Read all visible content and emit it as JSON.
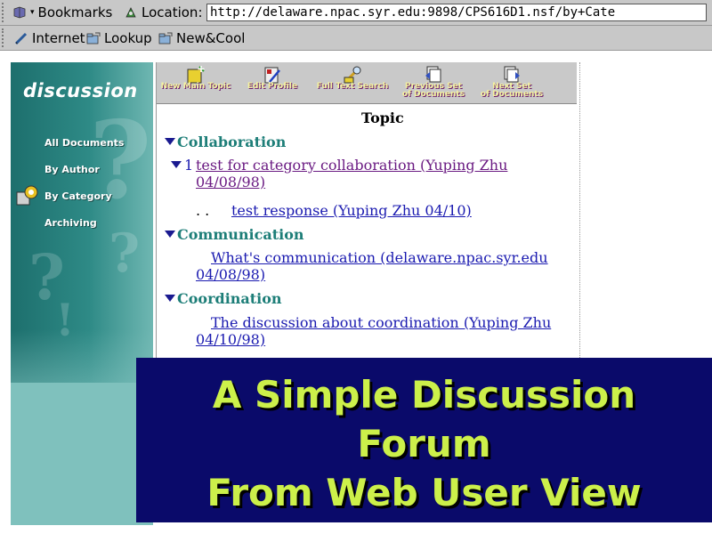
{
  "browser": {
    "toolbar": {
      "bookmarks_label": "Bookmarks",
      "location_label": "Location:",
      "url": "http://delaware.npac.syr.edu:9898/CPS616D1.nsf/by+Cate"
    },
    "personal_toolbar": [
      {
        "label": "Internet"
      },
      {
        "label": "Lookup"
      },
      {
        "label": "New&Cool"
      }
    ]
  },
  "sidebar": {
    "brand": "discussion",
    "links": [
      {
        "label": "All Documents"
      },
      {
        "label": "By Author"
      },
      {
        "label": "By Category"
      },
      {
        "label": "Archiving"
      }
    ]
  },
  "action_bar": [
    {
      "label": "New Main Topic",
      "icon": "new-topic-icon"
    },
    {
      "label": "Edit Profile",
      "icon": "edit-profile-icon"
    },
    {
      "label": "Full Text Search",
      "icon": "search-icon"
    },
    {
      "label_line1": "Previous Set",
      "label_line2": "of Documents",
      "icon": "previous-set-icon"
    },
    {
      "label_line1": "Next Set",
      "label_line2": "of Documents",
      "icon": "next-set-icon"
    }
  ],
  "view": {
    "column_header": "Topic",
    "categories": [
      {
        "name": "Collaboration",
        "documents": [
          {
            "count": "1",
            "title_line1": "test for category collaboration (Yuping Zhu",
            "title_line2": "04/08/98)"
          },
          {
            "prefix": ". .",
            "title": "test response (Yuping Zhu 04/10)"
          }
        ]
      },
      {
        "name": "Communication",
        "documents": [
          {
            "title_line1": "What's communication (delaware.npac.syr.edu",
            "title_line2": "04/08/98)"
          }
        ]
      },
      {
        "name": "Coordination",
        "documents": [
          {
            "title_line1": "The discussion about coordination (Yuping Zhu",
            "title_line2": "04/10/98)"
          }
        ]
      }
    ]
  },
  "overlay": {
    "line1": "A Simple Discussion",
    "line2": "Forum",
    "line3": "From Web User View"
  },
  "colors": {
    "sidebar_dark": "#1d6f6d",
    "sidebar_light": "#7fc1bd",
    "category_text": "#1d7e78",
    "overlay_bg": "#0a0a6a",
    "overlay_text": "#ccf04a"
  }
}
